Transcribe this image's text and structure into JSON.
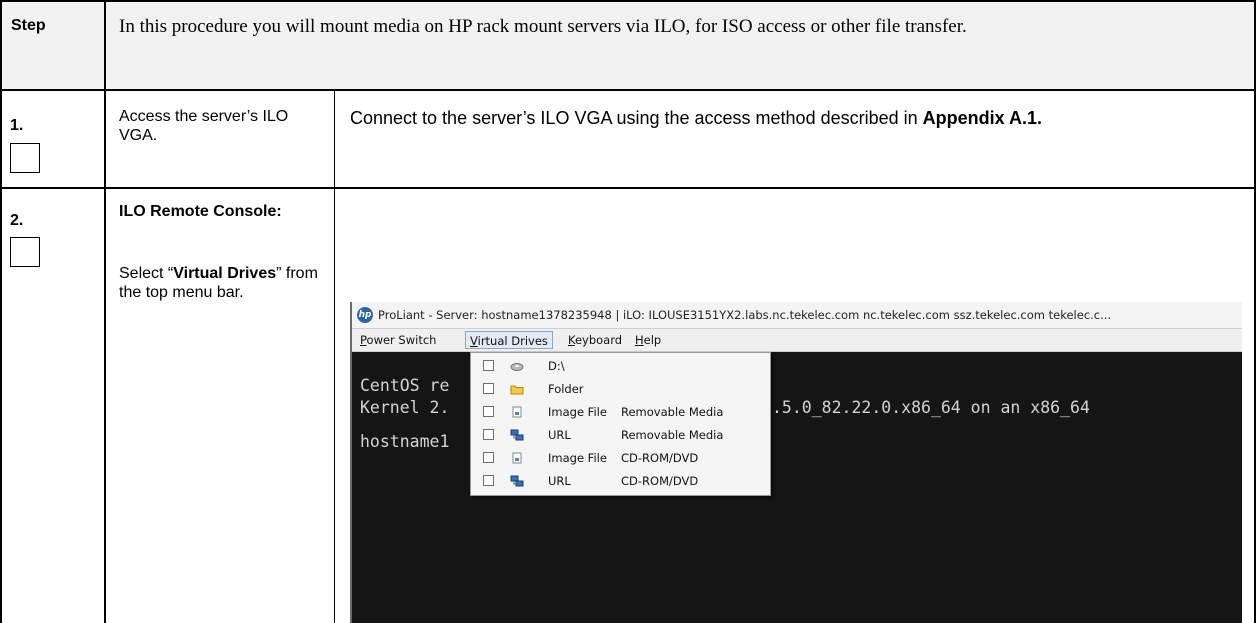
{
  "header": {
    "step_label": "Step",
    "intro": "In this procedure you will mount media on HP rack mount servers via ILO, for ISO access or other file transfer."
  },
  "steps": [
    {
      "number": "1.",
      "title": "Access the server’s ILO VGA.",
      "instruction_prefix": "Connect to the server’s ILO VGA using the access method described in ",
      "instruction_bold": "Appendix A.1."
    },
    {
      "number": "2.",
      "title_bold": "ILO Remote Console:",
      "select_pre": "Select “",
      "select_bold": "Virtual Drives",
      "select_post": "” from the top menu bar."
    }
  ],
  "screenshot": {
    "window_title": "ProLiant - Server: hostname1378235948 | iLO: ILOUSE3151YX2.labs.nc.tekelec.com nc.tekelec.com ssz.tekelec.com tekelec.c...",
    "menu": {
      "power_switch": "Power Switch",
      "virtual_drives": "Virtual Drives",
      "keyboard": "Keyboard",
      "help": "Help"
    },
    "console_lines": [
      "CentOS re",
      "Kernel 2.",
      "hostname1"
    ],
    "console_tail": ".5.0_82.22.0.x86_64 on an x86_64",
    "drives": [
      {
        "icon": "drive-icon",
        "label": "D:\\",
        "type": ""
      },
      {
        "icon": "folder-icon",
        "label": "Folder",
        "type": ""
      },
      {
        "icon": "image-file-icon",
        "label": "Image File",
        "type": "Removable Media"
      },
      {
        "icon": "network-url-icon",
        "label": "URL",
        "type": "Removable Media"
      },
      {
        "icon": "image-file-icon",
        "label": "Image File",
        "type": "CD-ROM/DVD"
      },
      {
        "icon": "network-url-icon",
        "label": "URL",
        "type": "CD-ROM/DVD"
      }
    ]
  }
}
